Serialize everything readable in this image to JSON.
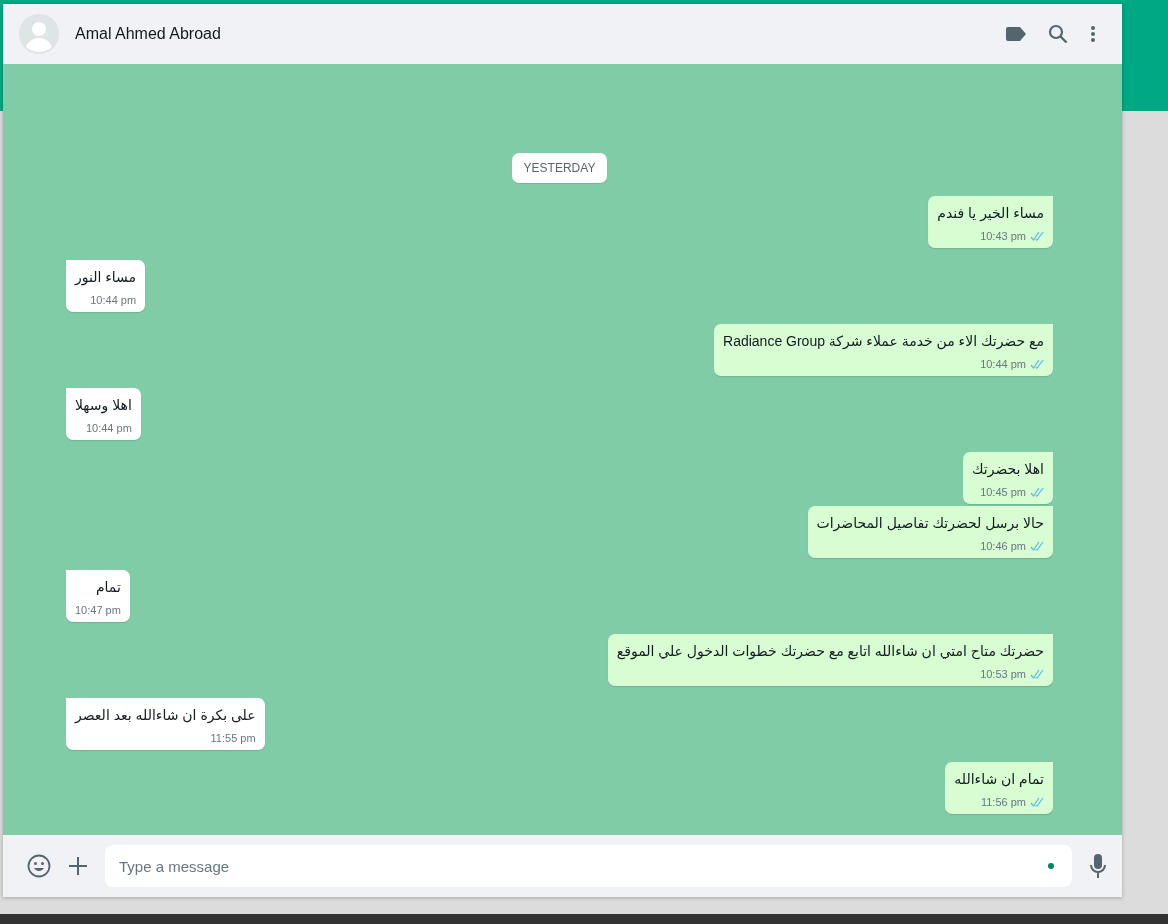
{
  "header": {
    "contact_name": "Amal Ahmed Abroad"
  },
  "chat": {
    "date_label": "YESTERDAY",
    "messages": [
      {
        "kind": "outgoing",
        "text": "مساء الخير يا فندم",
        "time": "10:43 pm"
      },
      {
        "kind": "incoming",
        "text": "مساء النور",
        "time": "10:44 pm"
      },
      {
        "kind": "outgoing",
        "text": "مع حضرتك الاء من خدمة عملاء شركة Radiance Group",
        "time": "10:44 pm"
      },
      {
        "kind": "incoming",
        "text": "اهلا وسهلا",
        "time": "10:44 pm"
      },
      {
        "kind": "outgoing",
        "text": "اهلا بحضرتك",
        "time": "10:45 pm"
      },
      {
        "kind": "outgoing",
        "text": "حالا برسل لحضرتك تفاصيل المحاضرات",
        "time": "10:46 pm"
      },
      {
        "kind": "incoming",
        "text": "تمام",
        "time": "10:47 pm"
      },
      {
        "kind": "outgoing",
        "text": "حضرتك متاح امتي ان شاءالله اتابع مع حضرتك خطوات الدخول علي الموقع",
        "time": "10:53 pm"
      },
      {
        "kind": "incoming",
        "text": "على بكرة ان شاءالله بعد العصر",
        "time": "11:55 pm"
      },
      {
        "kind": "outgoing",
        "text": "تمام ان شاءالله",
        "time": "11:56 pm"
      }
    ]
  },
  "composer": {
    "placeholder": "Type a message"
  }
}
